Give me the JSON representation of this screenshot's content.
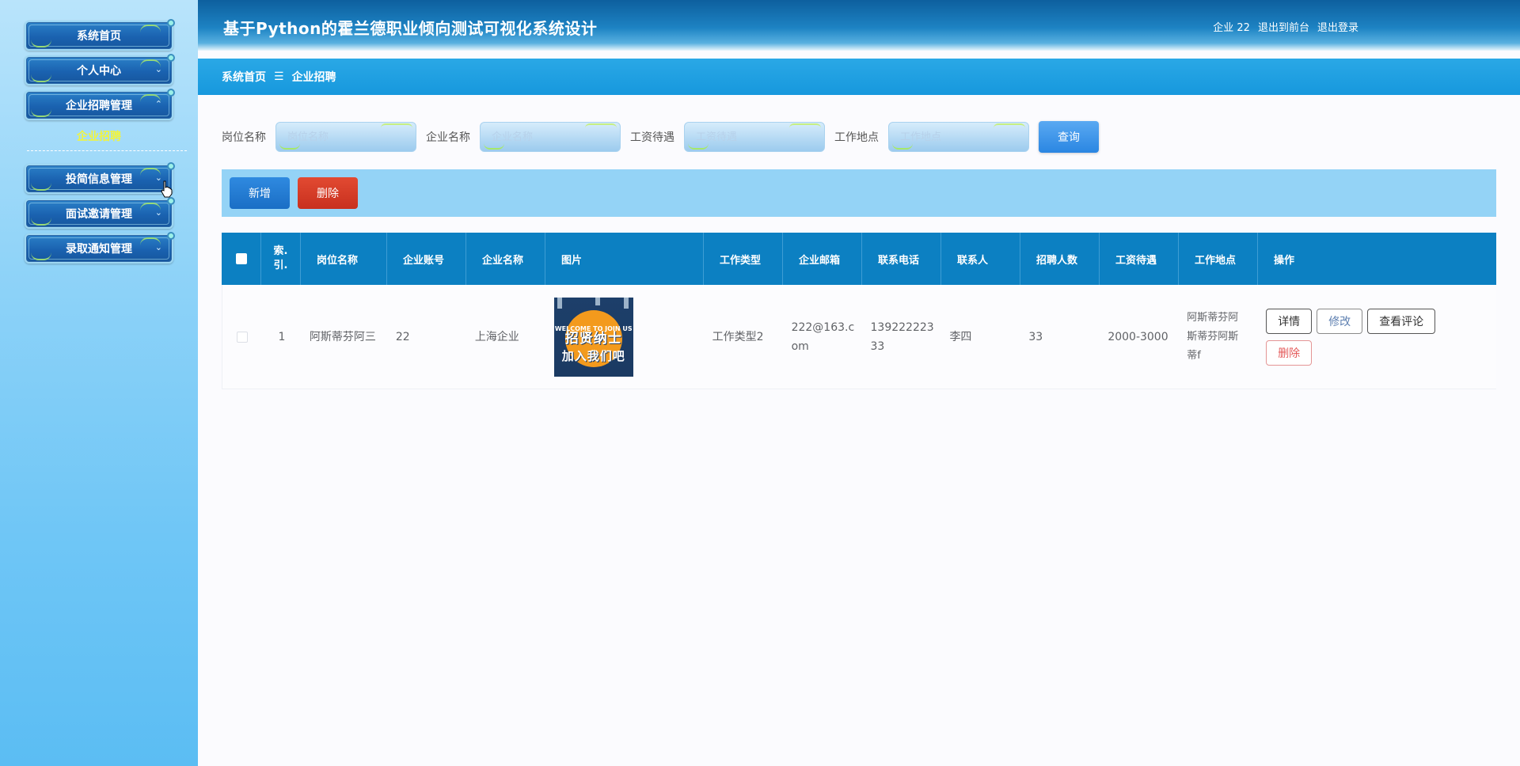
{
  "sidebar": {
    "menu": [
      {
        "label": "系统首页",
        "has_arrow": false
      },
      {
        "label": "个人中心",
        "has_arrow": true
      },
      {
        "label": "企业招聘管理",
        "has_arrow": true
      },
      {
        "label": "投简信息管理",
        "has_arrow": true
      },
      {
        "label": "面试邀请管理",
        "has_arrow": true
      },
      {
        "label": "录取通知管理",
        "has_arrow": true
      }
    ],
    "active_subitem": "企业招聘"
  },
  "header": {
    "title": "基于Python的霍兰德职业倾向测试可视化系统设计",
    "user_label": "企业 22",
    "back_to_front_label": "退出到前台",
    "logout_label": "退出登录"
  },
  "breadcrumb": {
    "home": "系统首页",
    "separator": "☰",
    "current": "企业招聘"
  },
  "search": {
    "fields": [
      {
        "label": "岗位名称",
        "placeholder": "岗位名称",
        "value": ""
      },
      {
        "label": "企业名称",
        "placeholder": "企业名称",
        "value": ""
      },
      {
        "label": "工资待遇",
        "placeholder": "工资待遇",
        "value": ""
      },
      {
        "label": "工作地点",
        "placeholder": "工作地点",
        "value": ""
      }
    ],
    "query_label": "查询"
  },
  "actions": {
    "add_label": "新增",
    "delete_label": "删除"
  },
  "table": {
    "columns": [
      "索引",
      "岗位名称",
      "企业账号",
      "企业名称",
      "图片",
      "工作类型",
      "企业邮箱",
      "联系电话",
      "联系人",
      "招聘人数",
      "工资待遇",
      "工作地点",
      "操作"
    ],
    "index_header_lines": [
      "索.",
      "引."
    ],
    "rows": [
      {
        "index": "1",
        "job_name": "阿斯蒂芬阿三",
        "account": "22",
        "company": "上海企业",
        "image_text_top": "WELCOME TO JOIN US",
        "image_text_main": "招贤纳士",
        "image_text_sub": "加入我们吧",
        "job_type": "工作类型2",
        "email_line1": "222@163.c",
        "email_line2": "om",
        "phone_line1": "139222223",
        "phone_line2": "33",
        "contact": "李四",
        "count": "33",
        "salary": "2000-3000",
        "location_line1": "阿斯蒂芬阿",
        "location_line2": "斯蒂芬阿斯",
        "location_line3": "蒂f",
        "ops": {
          "detail": "详情",
          "edit": "修改",
          "comments": "查看评论",
          "delete": "删除"
        }
      }
    ]
  },
  "colors": {
    "header_dark": "#0d5f9e",
    "breadcrumb": "#1798dd",
    "table_header": "#0c80c2",
    "action_bar": "#94d3f6",
    "add_button": "#1a6ec5",
    "delete_button": "#c8301e",
    "active_subitem": "#f2f53a"
  }
}
